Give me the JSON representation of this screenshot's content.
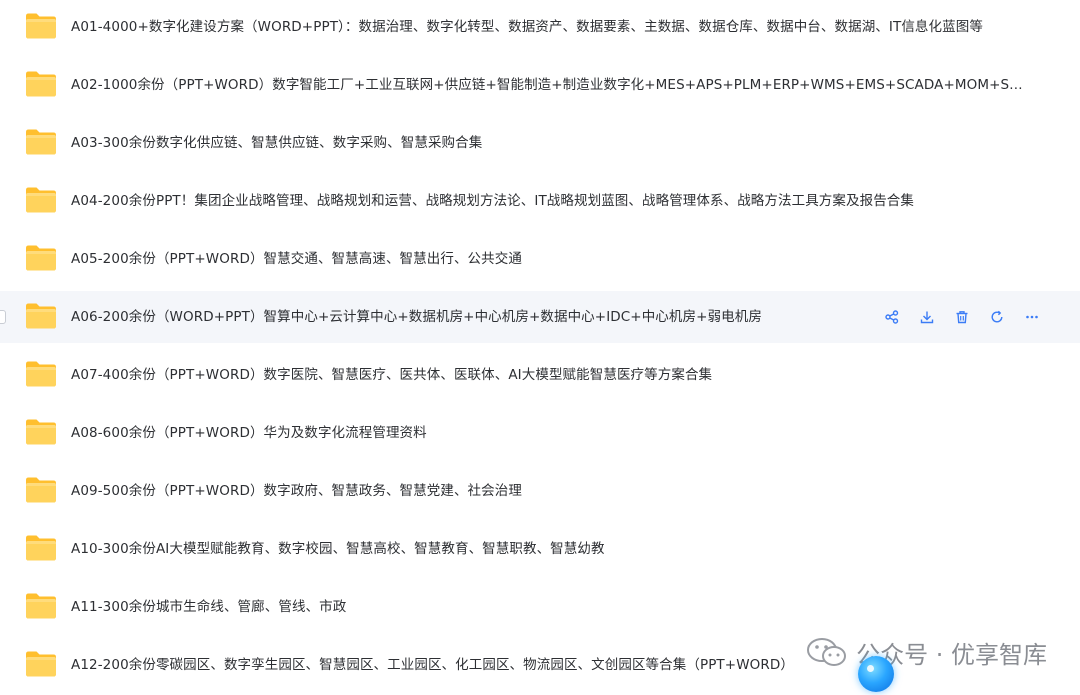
{
  "files": [
    {
      "name": "A01-4000+数字化建设方案（WORD+PPT）：数据治理、数字化转型、数据资产、数据要素、主数据、数据仓库、数据中台、数据湖、IT信息化蓝图等"
    },
    {
      "name": "A02-1000余份（PPT+WORD）数字智能工厂+工业互联网+供应链+智能制造+制造业数字化+MES+APS+PLM+ERP+WMS+EMS+SCADA+MOM+SCM+..."
    },
    {
      "name": "A03-300余份数字化供应链、智慧供应链、数字采购、智慧采购合集"
    },
    {
      "name": "A04-200余份PPT！集团企业战略管理、战略规划和运营、战略规划方法论、IT战略规划蓝图、战略管理体系、战略方法工具方案及报告合集"
    },
    {
      "name": "A05-200余份（PPT+WORD）智慧交通、智慧高速、智慧出行、公共交通"
    },
    {
      "name": "A06-200余份（WORD+PPT）智算中心+云计算中心+数据机房+中心机房+数据中心+IDC+中心机房+弱电机房"
    },
    {
      "name": "A07-400余份（PPT+WORD）数字医院、智慧医疗、医共体、医联体、AI大模型赋能智慧医疗等方案合集"
    },
    {
      "name": "A08-600余份（PPT+WORD）华为及数字化流程管理资料"
    },
    {
      "name": "A09-500余份（PPT+WORD）数字政府、智慧政务、智慧党建、社会治理"
    },
    {
      "name": "A10-300余份AI大模型赋能教育、数字校园、智慧高校、智慧教育、智慧职教、智慧幼教"
    },
    {
      "name": "A11-300余份城市生命线、管廊、管线、市政"
    },
    {
      "name": "A12-200余份零碳园区、数字孪生园区、智慧园区、工业园区、化工园区、物流园区、文创园区等合集（PPT+WORD）"
    }
  ],
  "hover_row_index": 5,
  "row_actions": [
    "share-icon",
    "download-icon",
    "delete-icon",
    "refresh-icon",
    "more-icon"
  ],
  "watermark": {
    "text": "公众号 · 优享智库"
  },
  "colors": {
    "folder_front": "#ffd35c",
    "folder_back": "#ffbf2e",
    "action_icon": "#3b7cf6",
    "hover_bg": "#f4f6fa"
  }
}
